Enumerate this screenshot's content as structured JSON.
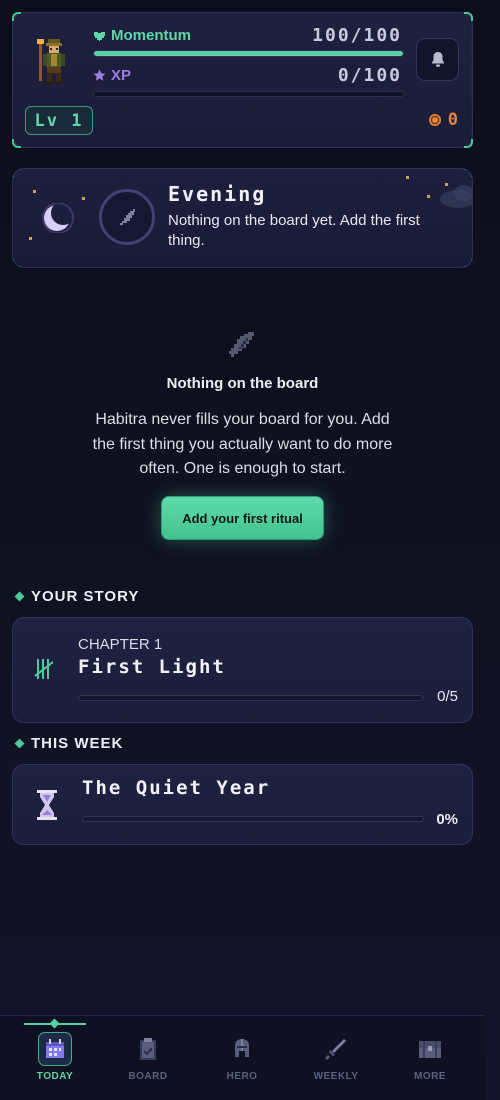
{
  "hero": {
    "momentum_label": "Momentum",
    "momentum_value": "100/100",
    "momentum_fraction": 1.0,
    "xp_label": "XP",
    "xp_value": "0/100",
    "xp_fraction": 0.0,
    "level": "Lv 1",
    "coins": "0"
  },
  "time_of_day": {
    "title": "Evening",
    "description": "Nothing on the board yet. Add the first thing."
  },
  "empty_state": {
    "title": "Nothing on the board",
    "description": "Habitra never fills your board for you. Add the first thing you actually want to do more often. One is enough to start.",
    "cta": "Add your first ritual"
  },
  "story": {
    "header": "YOUR STORY",
    "chapter": "CHAPTER 1",
    "title": "First Light",
    "progress": "0/5",
    "progress_fraction": 0.0
  },
  "week": {
    "header": "THIS WEEK",
    "title": "The Quiet Year",
    "progress": "0%",
    "progress_fraction": 0.0
  },
  "nav": {
    "items": [
      {
        "label": "TODAY",
        "icon": "calendar-icon",
        "active": true
      },
      {
        "label": "BOARD",
        "icon": "clipboard-icon",
        "active": false
      },
      {
        "label": "HERO",
        "icon": "helmet-icon",
        "active": false
      },
      {
        "label": "WEEKLY",
        "icon": "sword-icon",
        "active": false
      },
      {
        "label": "MORE",
        "icon": "chest-icon",
        "active": false
      }
    ]
  },
  "colors": {
    "accent": "#4fcb9a",
    "xp": "#9b7fe0",
    "coin": "#e8843a",
    "background": "#0d0f1d"
  }
}
